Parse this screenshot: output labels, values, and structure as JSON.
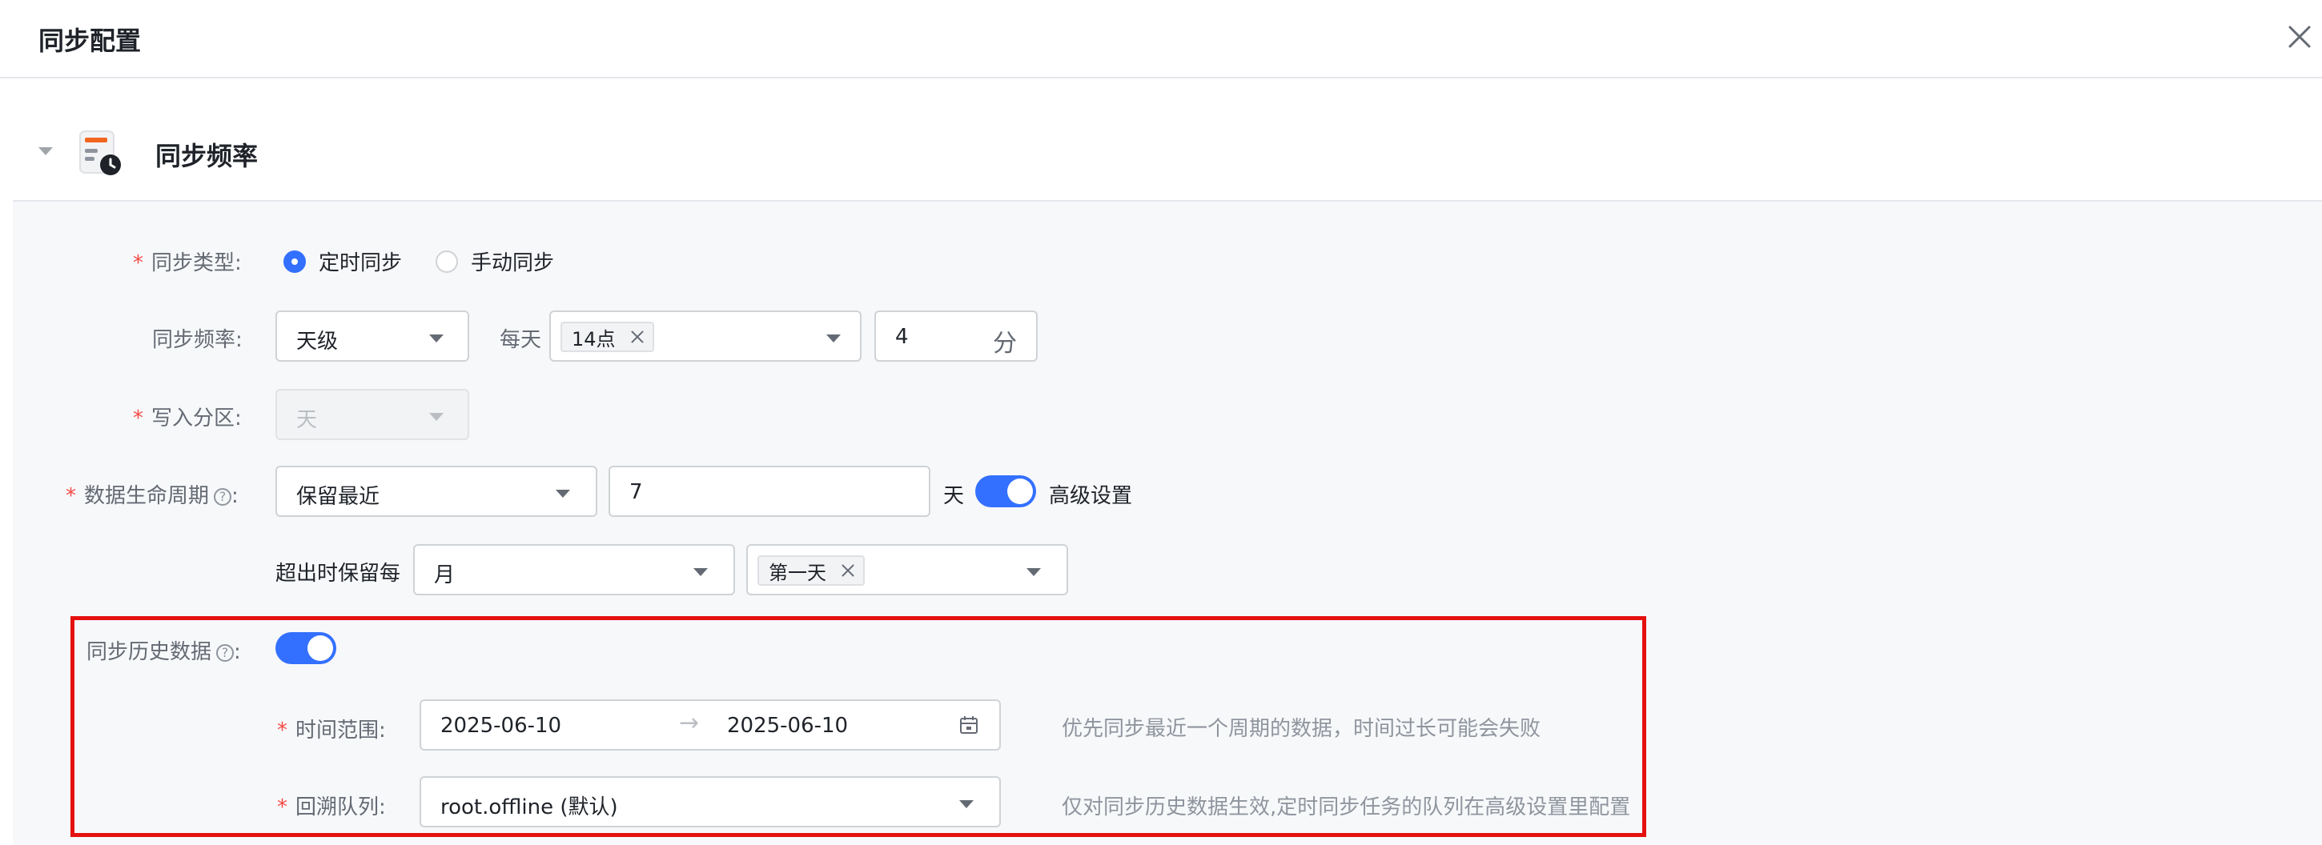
{
  "dialog": {
    "title": "同步配置"
  },
  "section": {
    "title": "同步频率"
  },
  "colors": {
    "accent": "#3370ff",
    "required": "#f54a45",
    "highlight": "#e4110f"
  },
  "icons": {
    "close": "close-icon",
    "collapse": "caret-down-icon",
    "section": "schedule-clock-icon",
    "help": "question-circle-icon",
    "calendar": "calendar-icon",
    "dropdown": "chevron-down-icon"
  },
  "form": {
    "sync_type": {
      "label": "同步类型",
      "colon": ":",
      "required": "*",
      "options": [
        {
          "label": "定时同步",
          "checked": true
        },
        {
          "label": "手动同步",
          "checked": false
        }
      ]
    },
    "sync_frequency": {
      "label": "同步频率",
      "colon": ":",
      "select_value": "天级",
      "each_day_label": "每天",
      "hour_tag": "14点",
      "minute_value": "4",
      "minute_unit": "分"
    },
    "write_partition": {
      "label": "写入分区",
      "colon": ":",
      "required": "*",
      "select_value": "天",
      "disabled": true
    },
    "data_lifecycle": {
      "label": "数据生命周期",
      "colon": ":",
      "required": "*",
      "help": "?",
      "select_value": "保留最近",
      "days_value": "7",
      "days_unit": "天",
      "advanced_switch_on": true,
      "advanced_label": "高级设置"
    },
    "retention": {
      "label": "超出时保留每",
      "period_value": "月",
      "day_tag": "第一天"
    },
    "sync_history": {
      "label": "同步历史数据",
      "colon": ":",
      "help": "?",
      "switch_on": true
    },
    "time_range": {
      "label": "时间范围",
      "colon": ":",
      "required": "*",
      "start": "2025-06-10",
      "arrow": "→",
      "end": "2025-06-10",
      "hint": "优先同步最近一个周期的数据，时间过长可能会失败"
    },
    "backfill_queue": {
      "label": "回溯队列",
      "colon": ":",
      "required": "*",
      "select_value": "root.offline (默认)",
      "hint": "仅对同步历史数据生效,定时同步任务的队列在高级设置里配置"
    }
  }
}
